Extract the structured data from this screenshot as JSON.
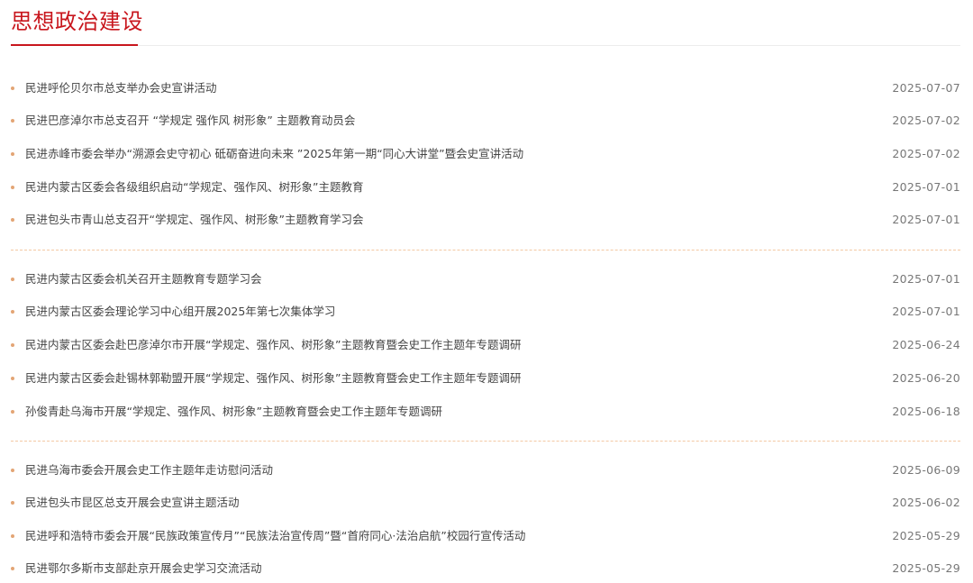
{
  "section": {
    "title": "思想政治建设"
  },
  "groups": [
    {
      "items": [
        {
          "title": "民进呼伦贝尔市总支举办会史宣讲活动",
          "date": "2025-07-07"
        },
        {
          "title": "民进巴彦淖尔市总支召开 “学规定 强作风 树形象” 主题教育动员会",
          "date": "2025-07-02"
        },
        {
          "title": "民进赤峰市委会举办“溯源会史守初心 砥砺奋进向未来 ”2025年第一期“同心大讲堂”暨会史宣讲活动",
          "date": "2025-07-02"
        },
        {
          "title": "民进内蒙古区委会各级组织启动“学规定、强作风、树形象”主题教育",
          "date": "2025-07-01"
        },
        {
          "title": "民进包头市青山总支召开“学规定、强作风、树形象”主题教育学习会",
          "date": "2025-07-01"
        }
      ]
    },
    {
      "items": [
        {
          "title": "民进内蒙古区委会机关召开主题教育专题学习会",
          "date": "2025-07-01"
        },
        {
          "title": "民进内蒙古区委会理论学习中心组开展2025年第七次集体学习",
          "date": "2025-07-01"
        },
        {
          "title": "民进内蒙古区委会赴巴彦淖尔市开展“学规定、强作风、树形象”主题教育暨会史工作主题年专题调研",
          "date": "2025-06-24"
        },
        {
          "title": "民进内蒙古区委会赴锡林郭勒盟开展“学规定、强作风、树形象”主题教育暨会史工作主题年专题调研",
          "date": "2025-06-20"
        },
        {
          "title": "孙俊青赴乌海市开展“学规定、强作风、树形象”主题教育暨会史工作主题年专题调研",
          "date": "2025-06-18"
        }
      ]
    },
    {
      "items": [
        {
          "title": "民进乌海市委会开展会史工作主题年走访慰问活动",
          "date": "2025-06-09"
        },
        {
          "title": "民进包头市昆区总支开展会史宣讲主题活动",
          "date": "2025-06-02"
        },
        {
          "title": "民进呼和浩特市委会开展“民族政策宣传月”“民族法治宣传周”暨“首府同心·法治启航”校园行宣传活动",
          "date": "2025-05-29"
        },
        {
          "title": "民进鄂尔多斯市支部赴京开展会史学习交流活动",
          "date": "2025-05-29"
        }
      ]
    }
  ],
  "colors": {
    "accent": "#c8161d",
    "bullet": "#e3a575",
    "divider": "#f3c9a3",
    "text": "#444444",
    "date": "#777777"
  }
}
